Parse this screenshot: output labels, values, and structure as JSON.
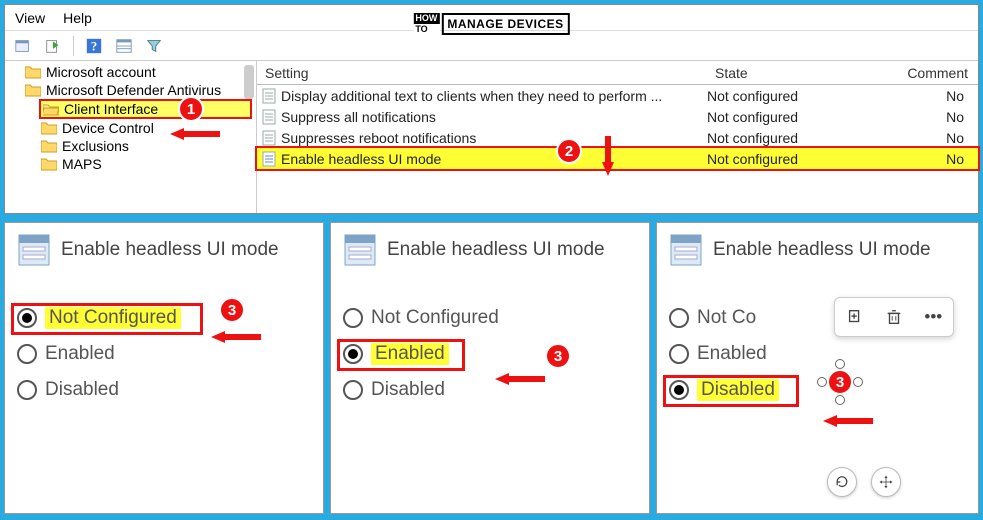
{
  "menu": {
    "view": "View",
    "help": "Help"
  },
  "watermark": {
    "how": "HOW",
    "to": "TO",
    "main": "MANAGE DEVICES"
  },
  "tree": {
    "items": [
      {
        "label": "Microsoft account",
        "indent": 1,
        "selected": false
      },
      {
        "label": "Microsoft Defender Antivirus",
        "indent": 1,
        "selected": false,
        "truncated": true
      },
      {
        "label": "Client Interface",
        "indent": 2,
        "selected": true
      },
      {
        "label": "Device Control",
        "indent": 2,
        "selected": false
      },
      {
        "label": "Exclusions",
        "indent": 2,
        "selected": false
      },
      {
        "label": "MAPS",
        "indent": 2,
        "selected": false
      }
    ]
  },
  "list": {
    "headers": {
      "setting": "Setting",
      "state": "State",
      "comment": "Comment"
    },
    "rows": [
      {
        "setting": "Display additional text to clients when they need to perform ...",
        "state": "Not configured",
        "comment": "No",
        "highlighted": false
      },
      {
        "setting": "Suppress all notifications",
        "state": "Not configured",
        "comment": "No",
        "highlighted": false
      },
      {
        "setting": "Suppresses reboot notifications",
        "state": "Not configured",
        "comment": "No",
        "highlighted": false
      },
      {
        "setting": "Enable headless UI mode",
        "state": "Not configured",
        "comment": "No",
        "highlighted": true
      }
    ]
  },
  "cards": {
    "title": "Enable headless UI mode",
    "options": {
      "not_configured": "Not Configured",
      "enabled": "Enabled",
      "disabled": "Disabled"
    },
    "card3_truncated_nc": "Not Co"
  },
  "annotations": {
    "one": "1",
    "two": "2",
    "three": "3"
  },
  "colors": {
    "accent_red": "#e11",
    "highlight_yellow": "#ffff33",
    "bg_blue": "#29abe2"
  }
}
